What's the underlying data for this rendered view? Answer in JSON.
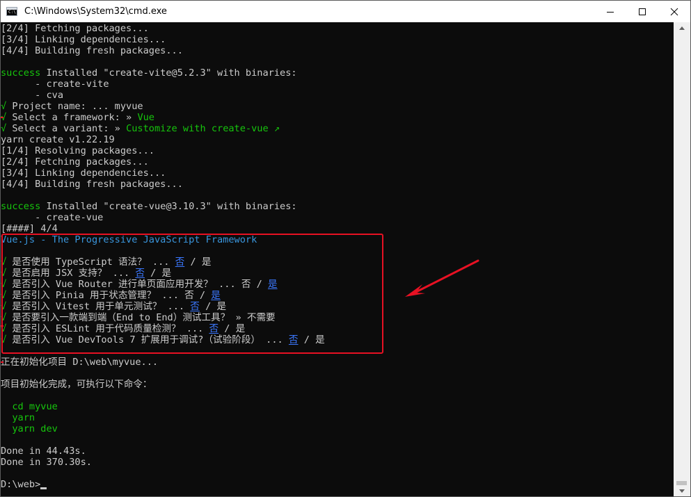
{
  "window": {
    "title": "C:\\Windows\\System32\\cmd.exe",
    "icon_label": "C:\\"
  },
  "terminal": {
    "lines": [
      [
        {
          "t": "[2/4] Fetching packages..."
        }
      ],
      [
        {
          "t": "[3/4] Linking dependencies..."
        }
      ],
      [
        {
          "t": "[4/4] Building fresh packages..."
        }
      ],
      [
        {
          "t": ""
        }
      ],
      [
        {
          "t": "success",
          "c": "green"
        },
        {
          "t": " Installed \"create-vite@5.2.3\" with binaries:"
        }
      ],
      [
        {
          "t": "      - create-vite"
        }
      ],
      [
        {
          "t": "      - cva"
        }
      ],
      [
        {
          "t": "√",
          "c": "green"
        },
        {
          "t": " Project name: ... myvue"
        }
      ],
      [
        {
          "t": "√",
          "c": "green"
        },
        {
          "t": " Select a framework: » "
        },
        {
          "t": "Vue",
          "c": "green"
        }
      ],
      [
        {
          "t": "√",
          "c": "green"
        },
        {
          "t": " Select a variant: » "
        },
        {
          "t": "Customize with create-vue ↗",
          "c": "green"
        }
      ],
      [
        {
          "t": "yarn create v1.22.19"
        }
      ],
      [
        {
          "t": "[1/4] Resolving packages..."
        }
      ],
      [
        {
          "t": "[2/4] Fetching packages..."
        }
      ],
      [
        {
          "t": "[3/4] Linking dependencies..."
        }
      ],
      [
        {
          "t": "[4/4] Building fresh packages..."
        }
      ],
      [
        {
          "t": ""
        }
      ],
      [
        {
          "t": "success",
          "c": "green"
        },
        {
          "t": " Installed \"create-vue@3.10.3\" with binaries:"
        }
      ],
      [
        {
          "t": "      - create-vue"
        }
      ],
      [
        {
          "t": "[####] 4/4"
        }
      ],
      [
        {
          "t": "Vue.js - The Progressive JavaScript Framework",
          "c": "cyan"
        }
      ],
      [
        {
          "t": ""
        }
      ],
      [
        {
          "t": "√",
          "c": "green"
        },
        {
          "t": " 是否使用 TypeScript 语法？ ... "
        },
        {
          "t": "否",
          "c": "blue"
        },
        {
          "t": " / 是"
        }
      ],
      [
        {
          "t": "√",
          "c": "green"
        },
        {
          "t": " 是否启用 JSX 支持？ ... "
        },
        {
          "t": "否",
          "c": "blue"
        },
        {
          "t": " / 是"
        }
      ],
      [
        {
          "t": "√",
          "c": "green"
        },
        {
          "t": " 是否引入 Vue Router 进行单页面应用开发？ ... 否 / "
        },
        {
          "t": "是",
          "c": "blue"
        }
      ],
      [
        {
          "t": "√",
          "c": "green"
        },
        {
          "t": " 是否引入 Pinia 用于状态管理？ ... 否 / "
        },
        {
          "t": "是",
          "c": "blue"
        }
      ],
      [
        {
          "t": "√",
          "c": "green"
        },
        {
          "t": " 是否引入 Vitest 用于单元测试？ ... "
        },
        {
          "t": "否",
          "c": "blue"
        },
        {
          "t": " / 是"
        }
      ],
      [
        {
          "t": "√",
          "c": "green"
        },
        {
          "t": " 是否要引入一款端到端（End to End）测试工具？ » 不需要"
        }
      ],
      [
        {
          "t": "√",
          "c": "green"
        },
        {
          "t": " 是否引入 ESLint 用于代码质量检测？ ... "
        },
        {
          "t": "否",
          "c": "blue"
        },
        {
          "t": " / 是"
        }
      ],
      [
        {
          "t": "√",
          "c": "green"
        },
        {
          "t": " 是否引入 Vue DevTools 7 扩展用于调试?（试验阶段） ... "
        },
        {
          "t": "否",
          "c": "blue"
        },
        {
          "t": " / 是"
        }
      ],
      [
        {
          "t": ""
        }
      ],
      [
        {
          "t": "正在初始化项目 D:\\web\\myvue..."
        }
      ],
      [
        {
          "t": ""
        }
      ],
      [
        {
          "t": "项目初始化完成，可执行以下命令："
        }
      ],
      [
        {
          "t": ""
        }
      ],
      [
        {
          "t": "  cd myvue",
          "c": "green"
        }
      ],
      [
        {
          "t": "  yarn",
          "c": "green"
        }
      ],
      [
        {
          "t": "  yarn dev",
          "c": "green"
        }
      ],
      [
        {
          "t": ""
        }
      ],
      [
        {
          "t": "Done in 44.43s."
        }
      ],
      [
        {
          "t": "Done in 370.30s."
        }
      ],
      [
        {
          "t": ""
        }
      ],
      [
        {
          "t": "D:\\web>"
        }
      ]
    ]
  },
  "colors": {
    "background": "#0c0c0c",
    "text": "#cccccc",
    "success_green": "#16c60c",
    "title_cyan": "#3a96dd",
    "selected_blue": "#3b78ff",
    "annotation_red": "#e81123"
  }
}
